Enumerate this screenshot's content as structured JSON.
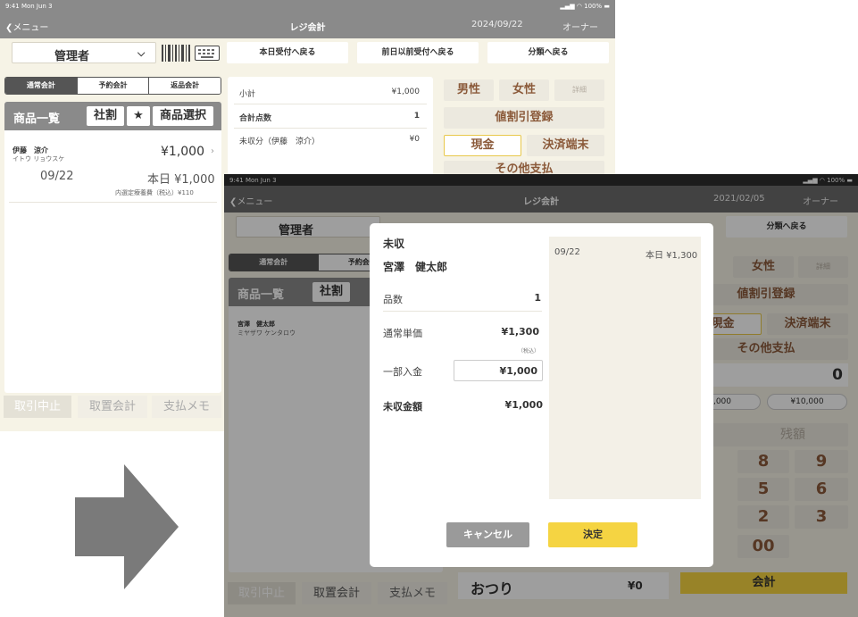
{
  "screen1": {
    "status": {
      "time": "9:41 Mon Jun 3",
      "battery": "100%"
    },
    "nav": {
      "back": "メニュー",
      "title": "レジ会計",
      "date": "2024/09/22",
      "role": "オーナー"
    },
    "staff": "管理者",
    "top_buttons": [
      "本日受付へ戻る",
      "前日以前受付へ戻る",
      "分類へ戻る"
    ],
    "tabs": [
      "通常会計",
      "予約会計",
      "返品会計"
    ],
    "product_header": {
      "title": "商品一覧",
      "discount": "社割",
      "star": "★",
      "select": "商品選択"
    },
    "patient": {
      "name": "伊藤　涼介",
      "kana": "イトウ リョウスケ",
      "amount": "¥1,000",
      "date": "09/22",
      "today_amount": "本日 ¥1,000",
      "note": "内選定療養費（税込）¥110"
    },
    "summary": [
      {
        "label": "小計",
        "value": "¥1,000"
      },
      {
        "label": "合計点数",
        "value": "1"
      },
      {
        "label": "未収分（伊藤　涼介）",
        "value": "¥0"
      }
    ],
    "right_buttons": {
      "male": "男性",
      "female": "女性",
      "detail": "詳細",
      "discount": "値割引登録",
      "cash": "現金",
      "terminal": "決済端末",
      "other": "その他支払"
    },
    "bottom": [
      "取引中止",
      "取置会計",
      "支払メモ"
    ]
  },
  "screen2": {
    "status": {
      "time": "9:41 Mon Jun 3",
      "battery": "100%"
    },
    "nav": {
      "back": "メニュー",
      "title": "レジ会計",
      "date": "2021/02/05",
      "role": "オーナー"
    },
    "staff": "管理者",
    "top_buttons": [
      "分類へ戻る"
    ],
    "tabs": [
      "通常会計",
      "予約会計"
    ],
    "product_header": {
      "title": "商品一覧",
      "discount": "社割"
    },
    "patient": {
      "name": "宮澤　健太郎",
      "kana": "ミヤザワ ケンタロウ"
    },
    "right_buttons": {
      "female": "女性",
      "detail": "詳細",
      "discount": "値割引登録",
      "cash": "現金",
      "terminal": "決済端末",
      "other": "その他支払"
    },
    "amount_display": "0",
    "quick": [
      ",000",
      "¥10,000"
    ],
    "balance_label": "残額",
    "keypad": [
      "8",
      "9",
      "5",
      "6",
      "2",
      "3",
      "00"
    ],
    "change": {
      "label": "おつり",
      "value": "¥0"
    },
    "checkout": "会計",
    "bottom": [
      "取引中止",
      "取置会計",
      "支払メモ"
    ],
    "dialog": {
      "title": "未収",
      "name": "宮澤　健太郎",
      "qty_label": "品数",
      "qty": "1",
      "price_label": "通常単価",
      "price": "¥1,300",
      "tax": "（税込）",
      "partial_label": "一部入金",
      "partial": "¥1,000",
      "unpaid_label": "未収金額",
      "unpaid": "¥1,000",
      "side_date": "09/22",
      "side_amount": "本日 ¥1,300",
      "cancel": "キャンセル",
      "ok": "決定"
    }
  },
  "colors": {
    "accent_yellow": "#f5d442",
    "brown_text": "#8b5a3a",
    "header_grey": "#8a8a8a"
  }
}
